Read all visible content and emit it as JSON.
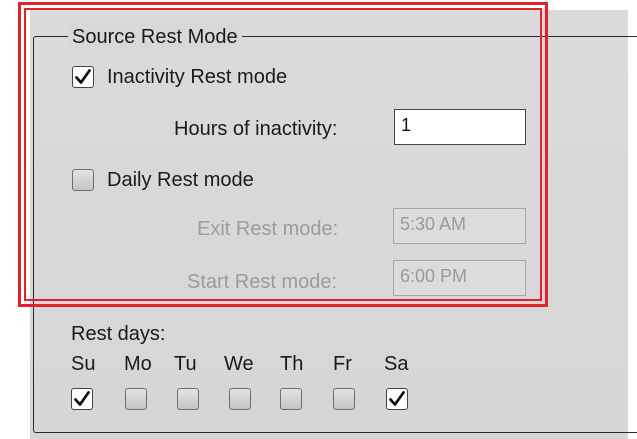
{
  "group": {
    "title": "Source Rest Mode"
  },
  "inactivity": {
    "checkbox_label": "Inactivity Rest mode",
    "checked": true,
    "hours_label": "Hours of inactivity:",
    "hours_value": "1"
  },
  "daily": {
    "checkbox_label": "Daily Rest mode",
    "checked": false,
    "exit_label": "Exit Rest mode:",
    "exit_value": "5:30 AM",
    "start_label": "Start Rest mode:",
    "start_value": "6:00 PM"
  },
  "rest_days": {
    "label": "Rest days:",
    "days": [
      {
        "label": "Su",
        "checked": true
      },
      {
        "label": "Mo",
        "checked": false
      },
      {
        "label": "Tu",
        "checked": false
      },
      {
        "label": "We",
        "checked": false
      },
      {
        "label": "Th",
        "checked": false
      },
      {
        "label": "Fr",
        "checked": false
      },
      {
        "label": "Sa",
        "checked": true
      }
    ]
  },
  "colors": {
    "highlight_frame": "#e5202a",
    "panel_background": "#d8d8d8",
    "disabled_text": "#9c9c9c"
  },
  "icons": {
    "checkmark": "checkmark-icon"
  }
}
